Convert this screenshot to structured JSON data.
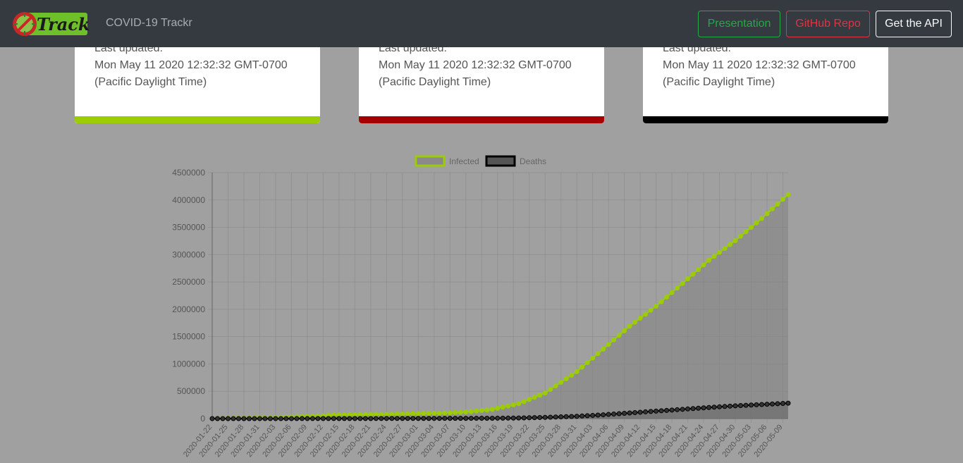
{
  "navbar": {
    "title": "COVID-19 Trackr",
    "logo_text": "Trackr",
    "buttons": {
      "presentation": "Presentation",
      "github": "GitHub Repo",
      "api": "Get the API"
    }
  },
  "cards": [
    {
      "label": "Last updated:",
      "date": "Mon May 11 2020 12:32:32 GMT-0700",
      "zone": "(Pacific Daylight Time)",
      "color": "#9ccc04"
    },
    {
      "label": "Last updated:",
      "date": "Mon May 11 2020 12:32:32 GMT-0700",
      "zone": "(Pacific Daylight Time)",
      "color": "#a50000"
    },
    {
      "label": "Last updated:",
      "date": "Mon May 11 2020 12:32:32 GMT-0700",
      "zone": "(Pacific Daylight Time)",
      "color": "#000000"
    }
  ],
  "colors": {
    "infected": "#9ccc04",
    "deaths": "#000000"
  },
  "chart_data": {
    "type": "line",
    "title": "",
    "xlabel": "",
    "ylabel": "",
    "ylim": [
      0,
      4500000
    ],
    "yticks": [
      0,
      500000,
      1000000,
      1500000,
      2000000,
      2500000,
      3000000,
      3500000,
      4000000,
      4500000
    ],
    "legend_position": "top",
    "grid": true,
    "x_start": "2020-01-22",
    "x_end": "2020-05-10",
    "xtick_labels": [
      "2020-01-22",
      "2020-01-25",
      "2020-01-28",
      "2020-01-31",
      "2020-02-03",
      "2020-02-06",
      "2020-02-09",
      "2020-02-12",
      "2020-02-15",
      "2020-02-18",
      "2020-02-21",
      "2020-02-24",
      "2020-02-27",
      "2020-03-01",
      "2020-03-04",
      "2020-03-07",
      "2020-03-10",
      "2020-03-13",
      "2020-03-16",
      "2020-03-19",
      "2020-03-22",
      "2020-03-25",
      "2020-03-28",
      "2020-03-31",
      "2020-04-03",
      "2020-04-06",
      "2020-04-09",
      "2020-04-12",
      "2020-04-15",
      "2020-04-18",
      "2020-04-21",
      "2020-04-24",
      "2020-04-27",
      "2020-04-30",
      "2020-05-03",
      "2020-05-06",
      "2020-05-09"
    ],
    "series": [
      {
        "name": "Infected",
        "keypoints": [
          [
            "2020-01-22",
            555
          ],
          [
            "2020-02-01",
            12000
          ],
          [
            "2020-02-10",
            40000
          ],
          [
            "2020-02-15",
            69000
          ],
          [
            "2020-02-25",
            80000
          ],
          [
            "2020-03-05",
            98000
          ],
          [
            "2020-03-10",
            119000
          ],
          [
            "2020-03-15",
            167000
          ],
          [
            "2020-03-20",
            272000
          ],
          [
            "2020-03-25",
            468000
          ],
          [
            "2020-03-31",
            858000
          ],
          [
            "2020-04-05",
            1272000
          ],
          [
            "2020-04-10",
            1691000
          ],
          [
            "2020-04-15",
            2056000
          ],
          [
            "2020-04-20",
            2472000
          ],
          [
            "2020-04-25",
            2897000
          ],
          [
            "2020-04-30",
            3256000
          ],
          [
            "2020-05-05",
            3662000
          ],
          [
            "2020-05-10",
            4100000
          ]
        ]
      },
      {
        "name": "Deaths",
        "keypoints": [
          [
            "2020-01-22",
            17
          ],
          [
            "2020-02-10",
            1000
          ],
          [
            "2020-03-01",
            3000
          ],
          [
            "2020-03-15",
            6500
          ],
          [
            "2020-03-20",
            11000
          ],
          [
            "2020-03-25",
            22000
          ],
          [
            "2020-03-31",
            42000
          ],
          [
            "2020-04-05",
            70000
          ],
          [
            "2020-04-10",
            103000
          ],
          [
            "2020-04-15",
            137000
          ],
          [
            "2020-04-20",
            170000
          ],
          [
            "2020-04-25",
            203000
          ],
          [
            "2020-04-30",
            234000
          ],
          [
            "2020-05-05",
            258000
          ],
          [
            "2020-05-10",
            282000
          ]
        ]
      }
    ]
  }
}
